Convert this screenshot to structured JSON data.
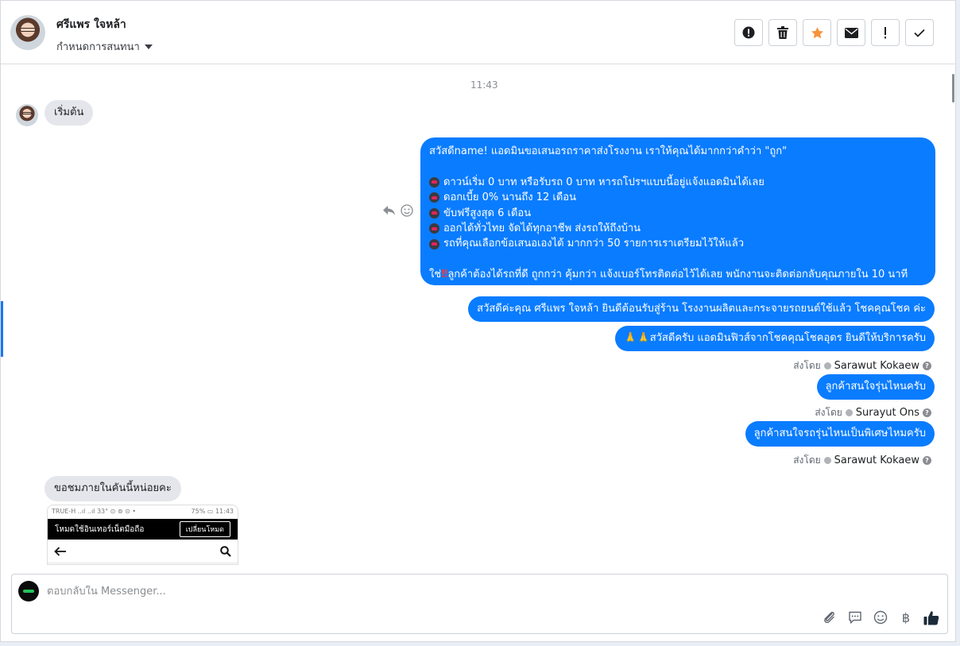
{
  "header": {
    "contact_name": "ศรีแพร ใจหล้า",
    "assign_label": "กำหนดการสนทนา"
  },
  "toolbar": {
    "buttons": [
      "alert-circle-icon",
      "trash-icon",
      "star-icon",
      "envelope-icon",
      "exclamation-icon",
      "check-icon"
    ],
    "accent_star": "#f7923a"
  },
  "chat": {
    "time": "11:43",
    "incoming_start": "เริ่มต้น",
    "big_message": {
      "l1": "สวัสดีname! แอดมินขอเสนอรถราคาส่งโรงงาน เราให้คุณได้มากกว่าคำว่า \"ถูก\"",
      "l2": "ดาวน์เริ่ม 0 บาท หรือรับรถ 0 บาท หารถโปรฯแบบนี้อยู่แจ้งแอดมินได้เลย",
      "l3": "ดอกเบี้ย 0% นานถึง 12 เดือน",
      "l4": "ขับฟรีสูงสุด 6 เดือน",
      "l5": "ออกได้ทั่วไทย จัดได้ทุกอาชีพ ส่งรถให้ถึงบ้าน",
      "l6": "รถที่คุณเลือกข้อเสนอเองได้ มากกว่า 50 รายการเราเตรียมไว้ให้แล้ว",
      "l7_pre": "ใช่",
      "l7_mark": "‼",
      "l7_post": "ลูกค้าต้องได้รถที่ดี ถูกกว่า คุ้มกว่า แจ้งเบอร์โทรติดต่อไว้ได้เลย พนักงานจะติดต่อกลับคุณภายใน 10 นาที"
    },
    "out2": "สวัสดีค่ะคุณ ศรีแพร ใจหล้า ยินดีต้อนรับสู่ร้าน โรงงานผลิตและกระจายรถยนต์ใช้แล้ว โชคคุณโชค ค่ะ",
    "out3": "🙏🙏สวัสดีครับ แอดมินฟิวส์จากโชคคุณโชคอุดร ยินดีให้บริการครับ",
    "sent_by_label": "ส่งโดย",
    "sender1": "Sarawut Kokaew",
    "out4": "ลูกค้าสนใจรุ่นไหนครับ",
    "sender2": "Surayut Ons",
    "out5": "ลูกค้าสนใจรถรุ่นไหนเป็นพิเศษไหมครับ",
    "sender3": "Sarawut Kokaew",
    "incoming2": "ขอชมภายในคันนี้หน่อยคะ",
    "shot": {
      "status_left": "TRUE-H ..ıl ..ıl  33° ⊙ ⊚ ⊙ •",
      "status_right": "75% ▭ 11:43",
      "bar_text": "โหมดใช้อินเทอร์เน็ตมือถือ",
      "bar_button": "เปลี่ยนโหมด"
    }
  },
  "composer": {
    "placeholder": "ตอบกลับใน Messenger...",
    "baht_symbol": "฿"
  },
  "colors": {
    "outgoing_bubble": "#0a7cff",
    "incoming_bubble": "#e4e6eb",
    "accent": "#1877f2"
  }
}
